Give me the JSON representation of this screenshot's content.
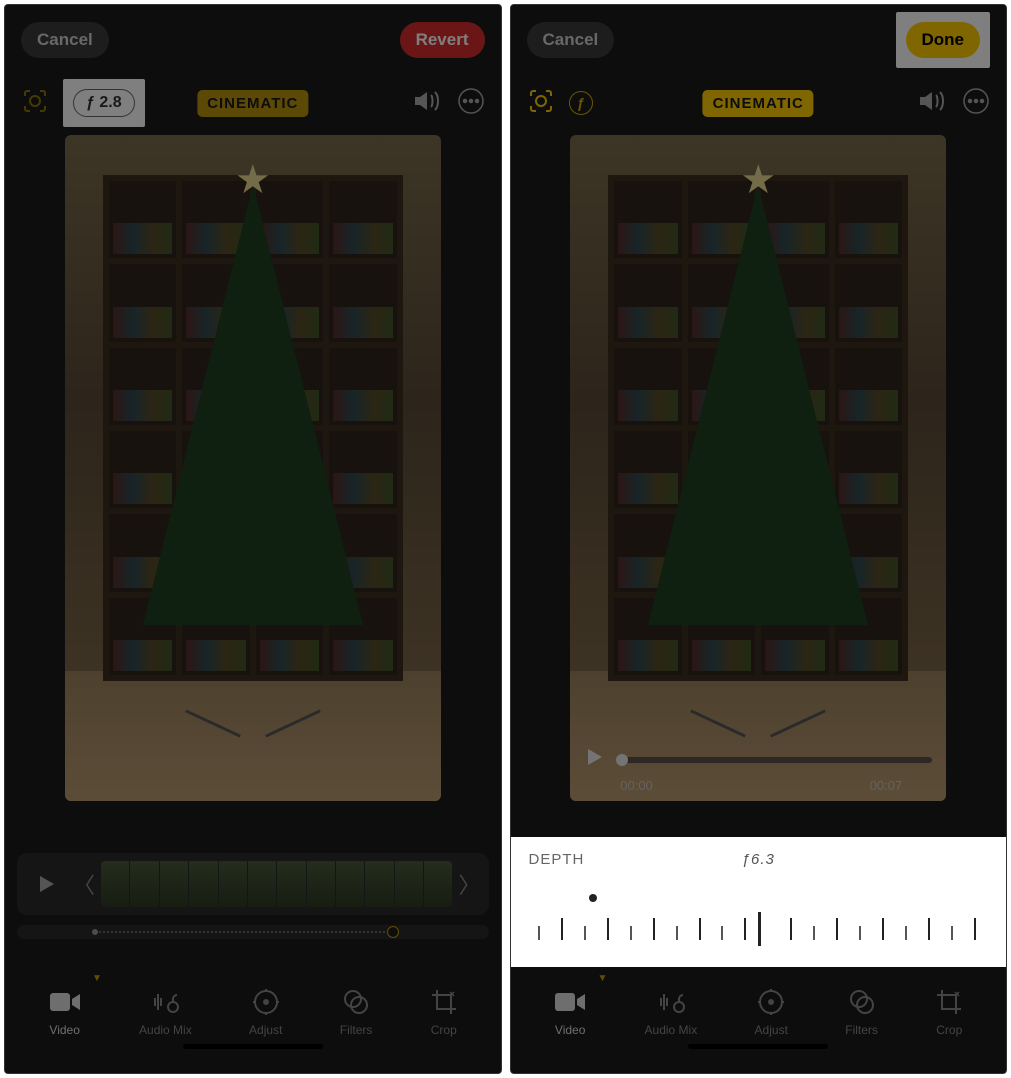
{
  "left": {
    "cancel_label": "Cancel",
    "revert_label": "Revert",
    "f_value": "ƒ 2.8",
    "cinematic_label": "CINEMATIC"
  },
  "right": {
    "cancel_label": "Cancel",
    "done_label": "Done",
    "cinematic_label": "CINEMATIC",
    "time_current": "00:00",
    "time_total": "00:07"
  },
  "depth": {
    "title": "DEPTH",
    "value": "ƒ6.3"
  },
  "tools": {
    "video": "Video",
    "audio_mix": "Audio Mix",
    "adjust": "Adjust",
    "filters": "Filters",
    "crop": "Crop"
  }
}
